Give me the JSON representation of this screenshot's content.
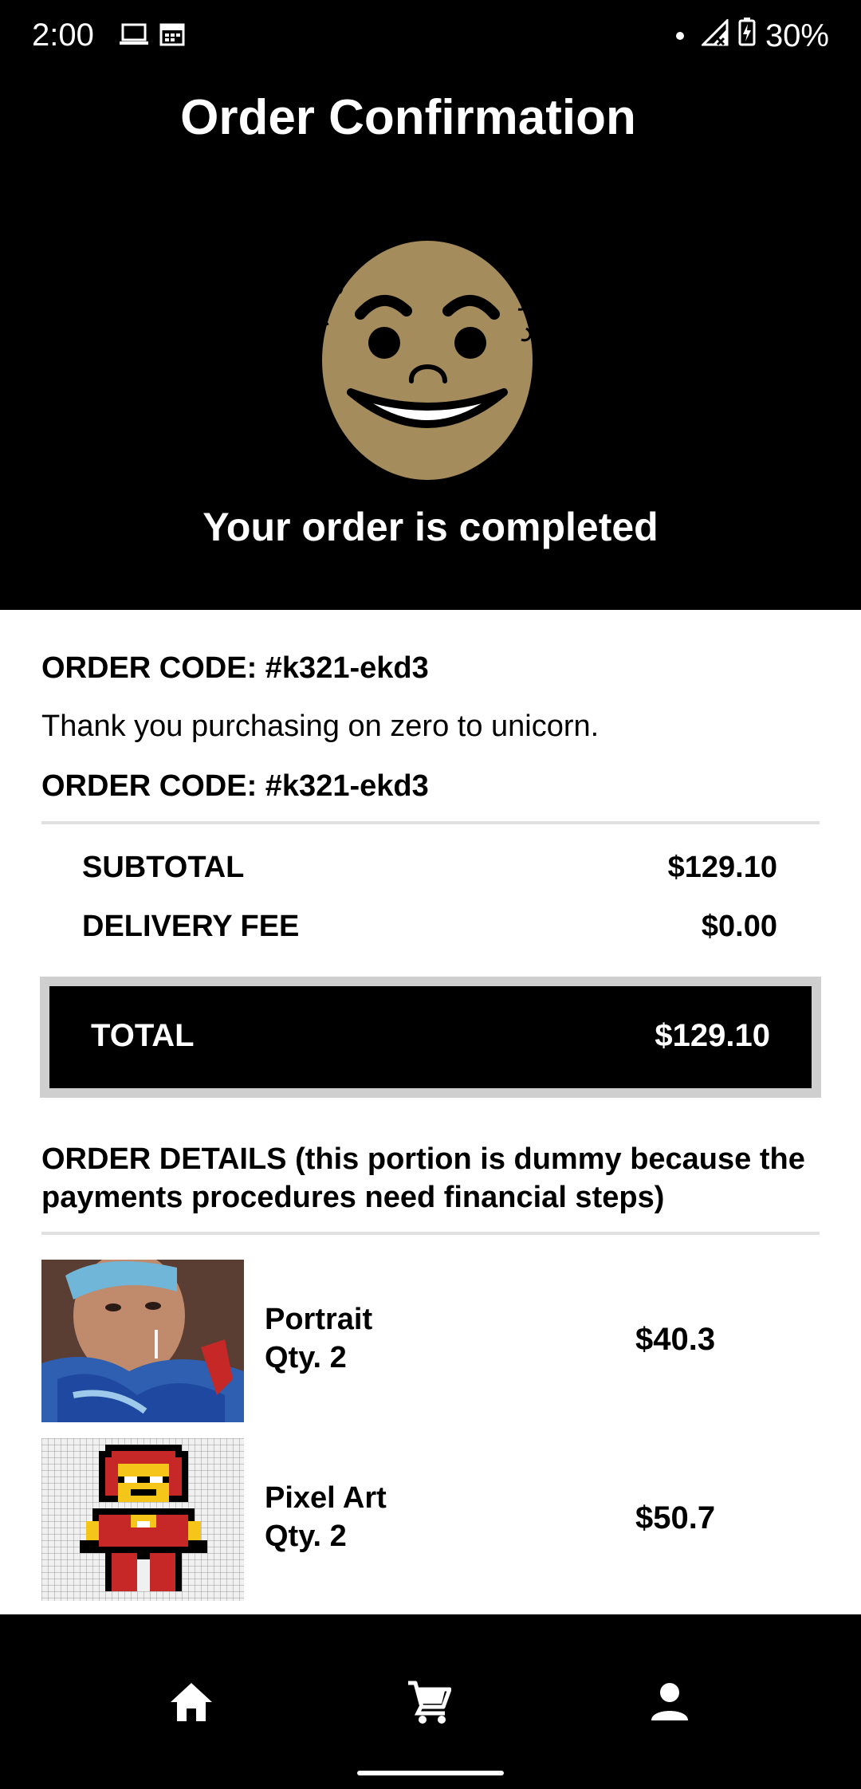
{
  "status_bar": {
    "time": "2:00",
    "battery": "30%",
    "icons": [
      "laptop-icon",
      "calendar-icon",
      "dot-icon",
      "signal-icon",
      "battery-charging-icon"
    ]
  },
  "header": {
    "title": "Order Confirmation",
    "mascot": "smiling-face-icon",
    "status": "Your order is completed"
  },
  "order": {
    "code_line_1": "ORDER CODE: #k321-ekd3",
    "thanks": "Thank you purchasing on zero to unicorn.",
    "code_line_2": "ORDER CODE: #k321-ekd3"
  },
  "summary": {
    "subtotal_label": "SUBTOTAL",
    "subtotal_value": "$129.10",
    "delivery_label": "DELIVERY FEE",
    "delivery_value": "$0.00",
    "total_label": "TOTAL",
    "total_value": "$129.10"
  },
  "details": {
    "title": "ORDER DETAILS (this portion is dummy because the payments procedures need financial steps)",
    "items": [
      {
        "name": "Portrait",
        "qty": "Qty. 2",
        "price": "$40.3",
        "thumb": "portrait-photo"
      },
      {
        "name": "Pixel Art",
        "qty": "Qty. 2",
        "price": "$50.7",
        "thumb": "pixel-art-ironman"
      }
    ]
  },
  "nav": {
    "items": [
      "home-icon",
      "cart-icon",
      "profile-icon"
    ]
  },
  "colors": {
    "background": "#000000",
    "surface": "#ffffff",
    "mascot_skin": "#a48c5c",
    "divider": "#e0e0e0"
  }
}
